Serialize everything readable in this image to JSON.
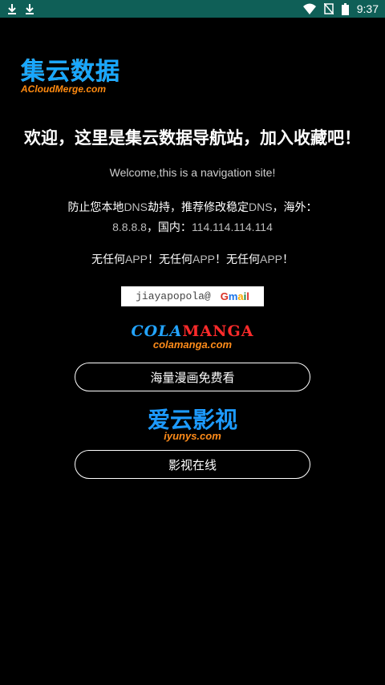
{
  "status_bar": {
    "time": "9:37",
    "icons": [
      "download-icon",
      "download-icon",
      "wifi-icon",
      "no-signal-icon",
      "battery-icon"
    ]
  },
  "logo": {
    "title": "集云数据",
    "subtitle": "ACloudMerge.com"
  },
  "welcome": {
    "cn": "欢迎，这里是集云数据导航站，加入收藏吧！",
    "en": "Welcome,this is a navigation site!"
  },
  "dns": {
    "part1": "防止您本地",
    "dns1": "DNS",
    "part2": "劫持，推荐修改稳定",
    "dns2": "DNS",
    "part3": "，海外：",
    "overseas": "8.8.8.8",
    "part4": "，国内：",
    "domestic": "114.114.114.114"
  },
  "no_app": {
    "prefix": "无任何",
    "app": "APP",
    "suffix": "！"
  },
  "email": {
    "user": "jiayapopola@",
    "provider_g": "G",
    "provider_m": "m",
    "provider_a": "a",
    "provider_i": "i",
    "provider_l": "l"
  },
  "sites": [
    {
      "logo_part1": "COLA",
      "logo_part2": "MANGA",
      "domain": "colamanga.com",
      "button_label": "海量漫画免费看"
    },
    {
      "logo_text": "爱云影视",
      "domain": "iyunys.com",
      "button_label": "影视在线"
    }
  ]
}
